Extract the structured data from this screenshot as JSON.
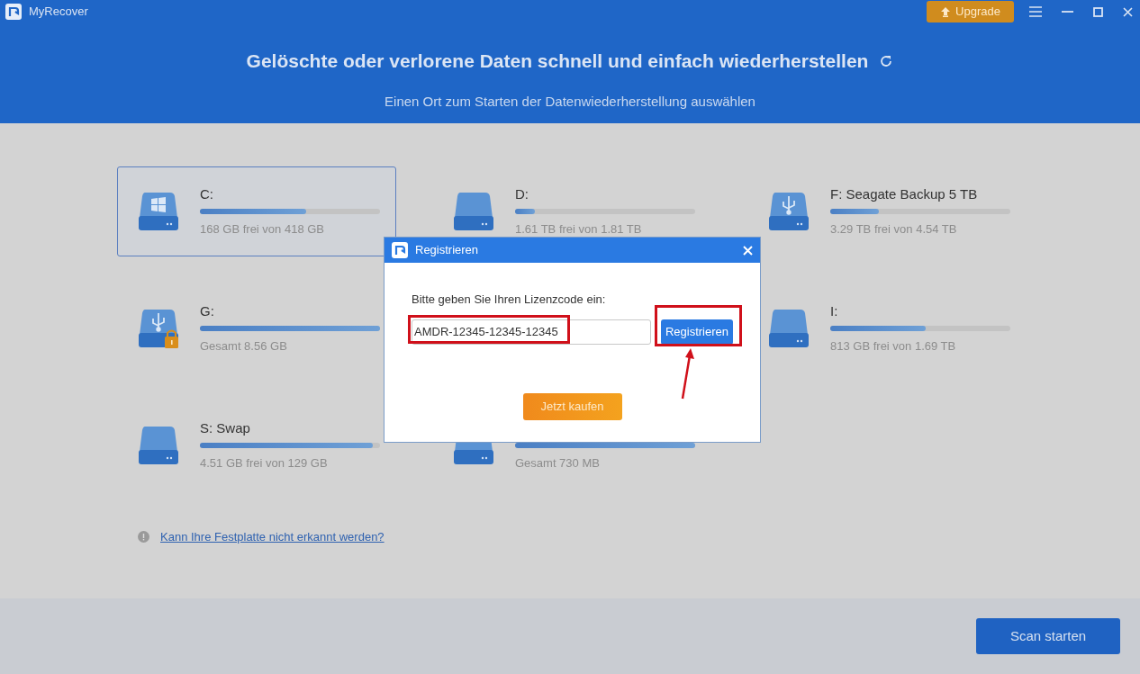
{
  "window": {
    "title": "MyRecover",
    "upgrade_label": "Upgrade"
  },
  "header": {
    "title": "Gelöschte oder verlorene Daten schnell und einfach wiederherstellen",
    "subtitle": "Einen Ort zum Starten der Datenwiederherstellung auswählen"
  },
  "drives": [
    {
      "name": "C:",
      "info": "168 GB frei von 418 GB",
      "level": 0.59,
      "kind": "windows",
      "selected": true
    },
    {
      "name": "D:",
      "info": "1.61 TB frei von 1.81 TB",
      "level": 0.11,
      "kind": "plain",
      "selected": false
    },
    {
      "name": "F: Seagate Backup 5 TB",
      "info": "3.29 TB frei von 4.54 TB",
      "level": 0.27,
      "kind": "usb",
      "selected": false
    },
    {
      "name": "G:",
      "info": "Gesamt 8.56 GB",
      "level": 1,
      "kind": "usb-locked",
      "selected": false
    },
    {
      "name": "I:",
      "info": "813 GB frei von 1.69 TB",
      "level": 0.53,
      "kind": "plain",
      "selected": false
    },
    {
      "name": "S: Swap",
      "info": "4.51 GB frei von 129 GB",
      "level": 0.96,
      "kind": "plain",
      "selected": false
    },
    {
      "info": "Gesamt 730 MB",
      "level": 1,
      "kind": "plain",
      "selected": false
    }
  ],
  "help_link": "Kann Ihre Festplatte nicht erkannt werden?",
  "scan_button": "Scan starten",
  "dialog": {
    "title": "Registrieren",
    "prompt": "Bitte geben Sie Ihren Lizenzcode ein:",
    "license_value": "AMDR-12345-12345-12345",
    "register_button": "Registrieren",
    "buy_button": "Jetzt kaufen"
  }
}
